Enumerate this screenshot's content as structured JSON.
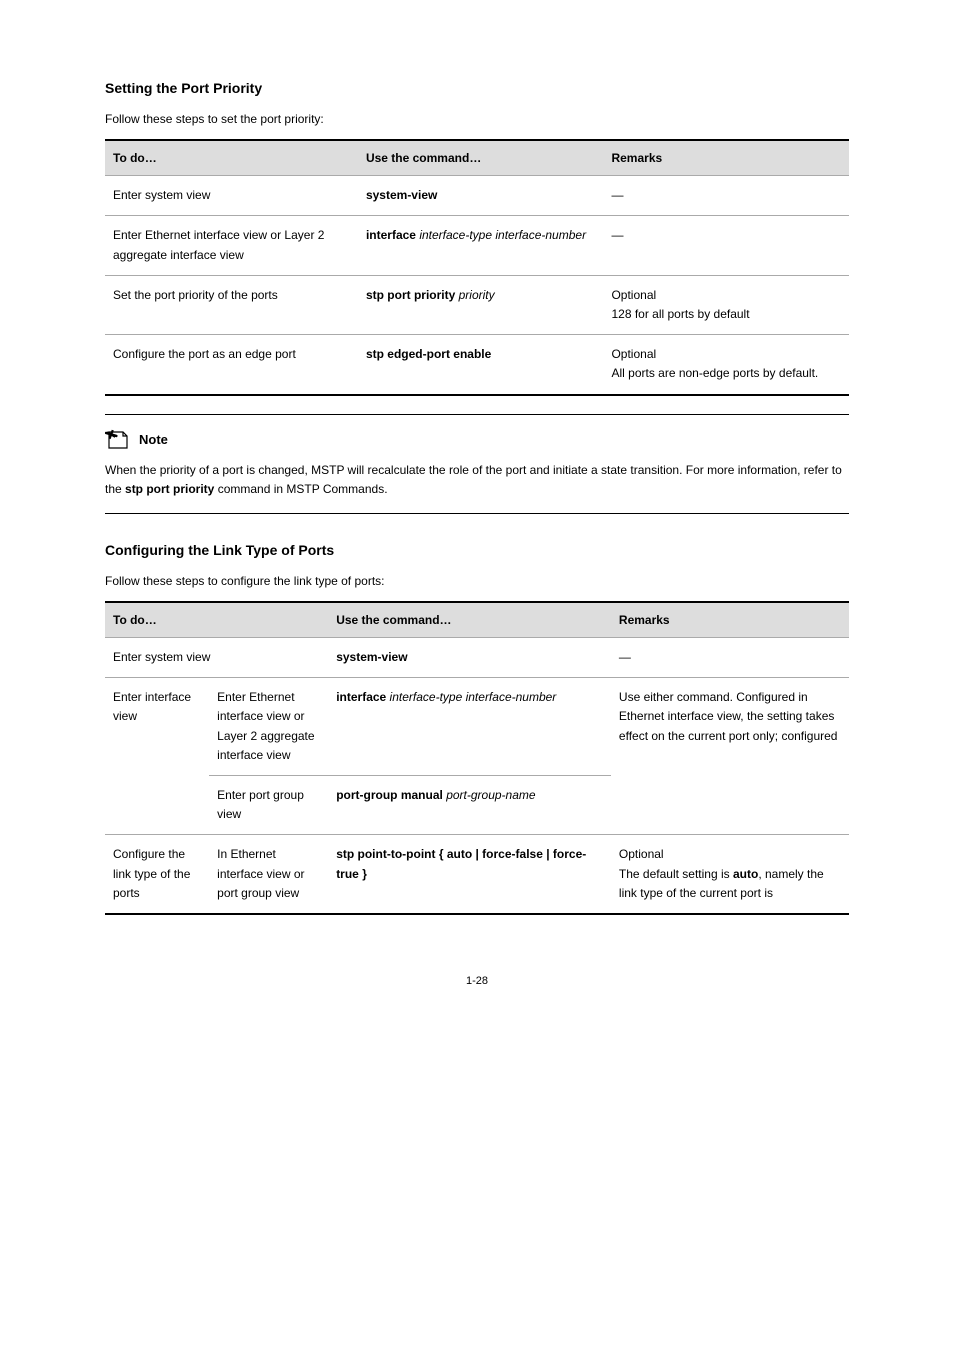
{
  "heading1": "Setting the Port Priority",
  "intro1": "Follow these steps to set the port priority:",
  "table1": {
    "headers": [
      "To do…",
      "Use the command…",
      "Remarks"
    ],
    "rows": [
      {
        "c1": "Enter system view",
        "c2": "system-view",
        "c3": "—"
      },
      {
        "c1": "Enter Ethernet interface view or Layer 2 aggregate interface view",
        "c2_prefix": "interface",
        "c2_args": " interface-type interface-number",
        "c3": "—"
      },
      {
        "c1": "Set the port priority of the ports",
        "c2_prefix": "stp port priority",
        "c2_args": " priority",
        "c3_line1": "Optional",
        "c3_line2": "128 for all ports by default"
      },
      {
        "c1": "Configure the port as an edge port",
        "c2_prefix": "stp edged-port enable",
        "c2_args": "",
        "c3_line1": "Optional",
        "c3_line2": "All ports are non-edge ports by default."
      }
    ]
  },
  "note": {
    "label": "Note",
    "body_before": "When the priority of a port is changed, MSTP will recalculate the role of the port and initiate a state transition. For more information, refer to the ",
    "body_bold": "stp port priority",
    "body_after": " command in MSTP Commands."
  },
  "heading2": "Configuring the Link Type of Ports",
  "intro2": "Follow these steps to configure the link type of ports:",
  "table2": {
    "headers": [
      "To do…",
      "Use the command…",
      "Remarks"
    ],
    "rows": [
      {
        "a": "Enter system view",
        "b": "system-view",
        "c": "—"
      },
      {
        "a": "Enter interface view",
        "sub": [
          {
            "l": "Enter Ethernet interface view or Layer 2 aggregate interface view",
            "m_prefix": "interface",
            "m_args": " interface-type interface-number"
          },
          {
            "l": "Enter port group view",
            "m_prefix": "port-group manual",
            "m_args": " port-group-name"
          }
        ],
        "c": "Use either command. Configured in Ethernet interface view, the setting takes effect on the current port only; configured"
      },
      {
        "a": "Configure the link type of the ports",
        "sub": [
          {
            "l": "In Ethernet interface view or port group view",
            "m_prefix": "stp point-to-point",
            "m_args": " { auto | force-false | force-true }"
          }
        ],
        "c_line1": "Optional",
        "c_line2_before": "The default setting is ",
        "c_line2_bold": "auto",
        "c_line2_after": ", namely the link type of the current port is"
      }
    ]
  },
  "pagenum": "1-28"
}
